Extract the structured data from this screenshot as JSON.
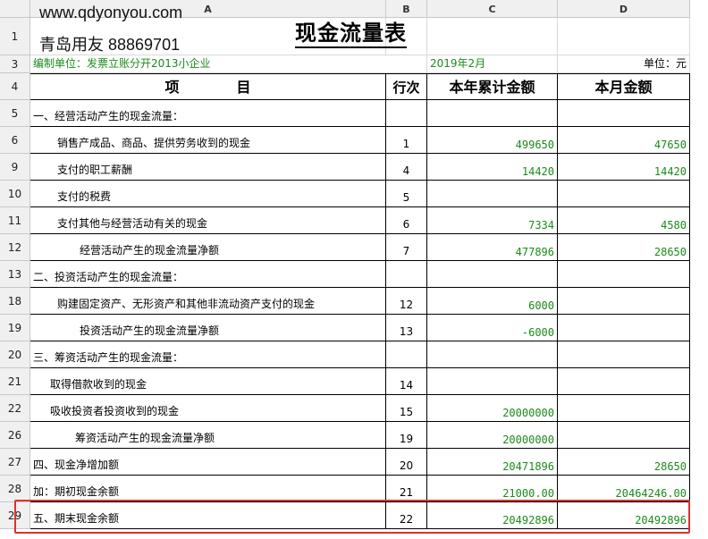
{
  "watermark": {
    "url": "www.qdyonyou.com",
    "phone": "青岛用友 88869701"
  },
  "columns": [
    "A",
    "B",
    "C",
    "D"
  ],
  "title": "现金流量表",
  "meta": {
    "company": "编制单位：发票立账分开2013小企业",
    "period": "2019年2月",
    "unit": "单位：元"
  },
  "headers": {
    "item": "项　　　　目",
    "line": "行次",
    "ytd": "本年累计金额",
    "month": "本月金额"
  },
  "rows": [
    {
      "rownum": "5",
      "label": "一、经营活动产生的现金流量：",
      "line": "",
      "ytd": "",
      "month": ""
    },
    {
      "rownum": "6",
      "label": "销售产成品、商品、提供劳务收到的现金",
      "line": "1",
      "ytd": "499650",
      "month": "47650"
    },
    {
      "rownum": "9",
      "label": "支付的职工薪酬",
      "line": "4",
      "ytd": "14420",
      "month": "14420"
    },
    {
      "rownum": "10",
      "label": "支付的税费",
      "line": "5",
      "ytd": "",
      "month": ""
    },
    {
      "rownum": "11",
      "label": "支付其他与经营活动有关的现金",
      "line": "6",
      "ytd": "7334",
      "month": "4580"
    },
    {
      "rownum": "12",
      "label": "经营活动产生的现金流量净额",
      "line": "7",
      "ytd": "477896",
      "month": "28650"
    },
    {
      "rownum": "13",
      "label": "二、投资活动产生的现金流量：",
      "line": "",
      "ytd": "",
      "month": ""
    },
    {
      "rownum": "18",
      "label": "购建固定资产、无形资产和其他非流动资产支付的现金",
      "line": "12",
      "ytd": "6000",
      "month": ""
    },
    {
      "rownum": "19",
      "label": "投资活动产生的现金流量净额",
      "line": "13",
      "ytd": "-6000",
      "month": ""
    },
    {
      "rownum": "20",
      "label": "三、筹资活动产生的现金流量：",
      "line": "",
      "ytd": "",
      "month": ""
    },
    {
      "rownum": "21",
      "label": "取得借款收到的现金",
      "line": "14",
      "ytd": "",
      "month": ""
    },
    {
      "rownum": "22",
      "label": "吸收投资者投资收到的现金",
      "line": "15",
      "ytd": "20000000",
      "month": ""
    },
    {
      "rownum": "26",
      "label": "筹资活动产生的现金流量净额",
      "line": "19",
      "ytd": "20000000",
      "month": ""
    },
    {
      "rownum": "27",
      "label": "四、现金净增加额",
      "line": "20",
      "ytd": "20471896",
      "month": "28650"
    },
    {
      "rownum": "28",
      "label": "加：期初现金余额",
      "line": "21",
      "ytd": "21000.00",
      "month": "20464246.00"
    },
    {
      "rownum": "29",
      "label": "五、期末现金余额",
      "line": "22",
      "ytd": "20492896",
      "month": "20492896"
    }
  ],
  "toprows": [
    "1",
    "3",
    "4"
  ],
  "colors": {
    "number": "#1a8a1a",
    "highlight": "#e03030",
    "header_bg": "#f0f0f0"
  }
}
